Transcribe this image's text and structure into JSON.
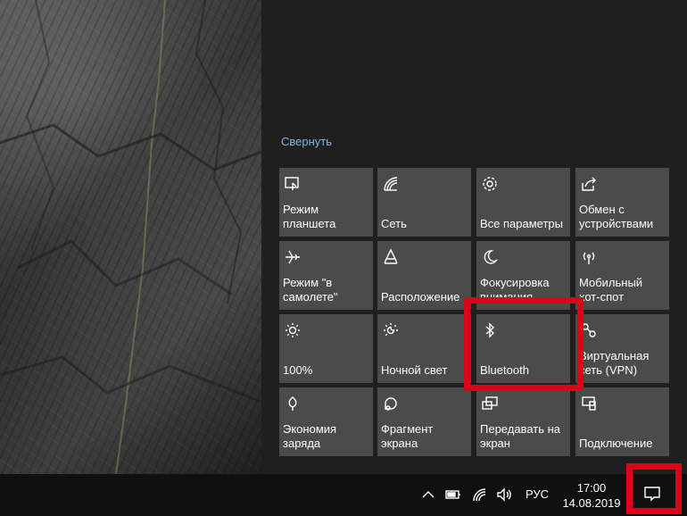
{
  "action_center": {
    "collapse_label": "Свернуть",
    "tiles": [
      {
        "id": "tablet-mode",
        "label": "Режим\nпланшета",
        "icon": "tablet-mode-icon"
      },
      {
        "id": "network",
        "label": "Сеть",
        "icon": "network-icon"
      },
      {
        "id": "all-settings",
        "label": "Все параметры",
        "icon": "gear-icon"
      },
      {
        "id": "nearby-sharing",
        "label": "Обмен с\nустройствами",
        "icon": "share-icon"
      },
      {
        "id": "airplane-mode",
        "label": "Режим \"в\nсамолете\"",
        "icon": "airplane-icon"
      },
      {
        "id": "location",
        "label": "Расположение",
        "icon": "location-icon"
      },
      {
        "id": "focus-assist",
        "label": "Фокусировка\nвнимания",
        "icon": "moon-icon"
      },
      {
        "id": "mobile-hotspot",
        "label": "Мобильный\nхот-спот",
        "icon": "hotspot-icon"
      },
      {
        "id": "brightness",
        "label": "100%",
        "icon": "sun-icon"
      },
      {
        "id": "night-light",
        "label": "Ночной свет",
        "icon": "night-light-icon"
      },
      {
        "id": "bluetooth",
        "label": "Bluetooth",
        "icon": "bluetooth-icon"
      },
      {
        "id": "vpn",
        "label": "Виртуальная\nсеть (VPN)",
        "icon": "vpn-icon"
      },
      {
        "id": "battery-saver",
        "label": "Экономия\nзаряда",
        "icon": "battery-saver-icon"
      },
      {
        "id": "screen-snip",
        "label": "Фрагмент\nэкрана",
        "icon": "snip-icon"
      },
      {
        "id": "project",
        "label": "Передавать на\nэкран",
        "icon": "project-icon"
      },
      {
        "id": "connect",
        "label": "Подключение",
        "icon": "connect-icon"
      }
    ]
  },
  "taskbar": {
    "language": "РУС",
    "time": "17:00",
    "date": "14.08.2019"
  },
  "colors": {
    "accent_link": "#7fb4e8",
    "tile_bg": "#4b4b4b",
    "highlight": "#e0001a",
    "taskbar_bg": "#101010"
  }
}
